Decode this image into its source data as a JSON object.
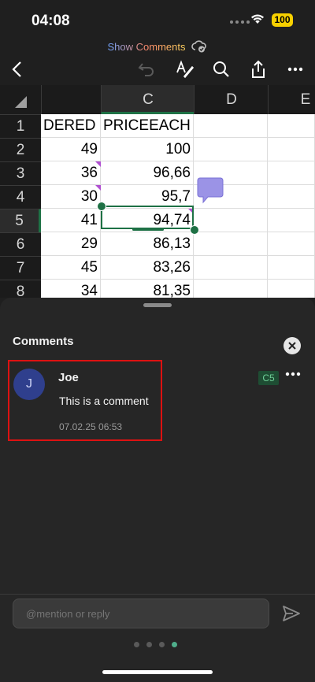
{
  "status_bar": {
    "time": "04:08",
    "battery": "100"
  },
  "document": {
    "title": "Show Comments"
  },
  "toolbar": {
    "back": "back-icon",
    "undo": "undo-icon",
    "format": "format-icon",
    "search": "search-icon",
    "share": "share-icon",
    "more": "more-icon"
  },
  "grid": {
    "columns": [
      "C",
      "D",
      "E"
    ],
    "rows": [
      "1",
      "2",
      "3",
      "4",
      "5",
      "6",
      "7",
      "8"
    ],
    "col_b": [
      "DERED",
      "49",
      "36",
      "30",
      "41",
      "29",
      "45",
      "34"
    ],
    "col_c": [
      "PRICEEACH",
      "100",
      "96,66",
      "95,7",
      "94,74",
      "86,13",
      "83,26",
      "81,35"
    ]
  },
  "comments_panel": {
    "title": "Comments",
    "comment": {
      "avatar_initial": "J",
      "author": "Joe",
      "text": "This is a comment",
      "date": "07.02.25 06:53",
      "cell_ref": "C5"
    },
    "reply_placeholder": "@mention or reply"
  },
  "colors": {
    "accent": "#1e7145",
    "highlight_border": "#dd1111",
    "avatar": "#2f3f8d"
  }
}
